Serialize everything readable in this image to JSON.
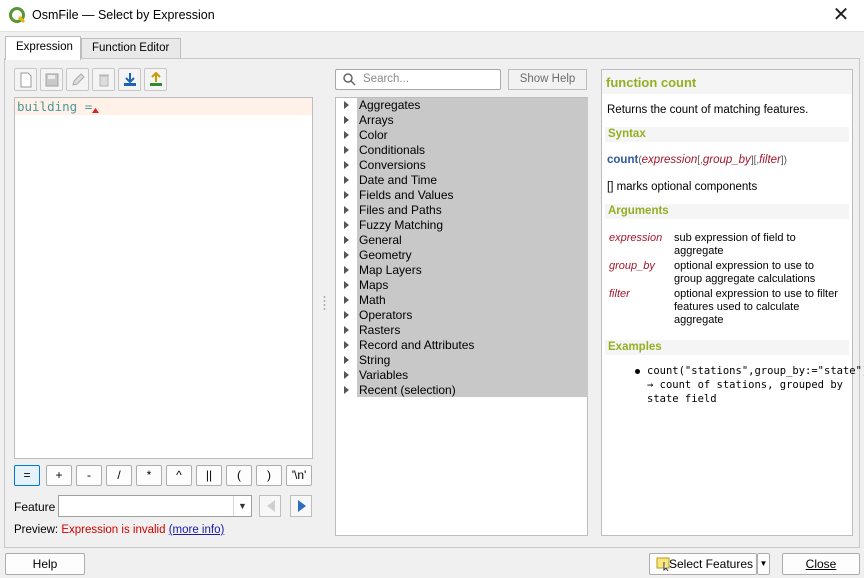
{
  "window": {
    "title": "OsmFile — Select by Expression",
    "close_glyph": "✕",
    "icon": "qgis-logo-icon"
  },
  "tabs": [
    {
      "label": "Expression",
      "active": true
    },
    {
      "label": "Function Editor",
      "active": false
    }
  ],
  "toolbar": {
    "icons": [
      "new-file-icon",
      "save-icon",
      "edit-icon",
      "delete-icon",
      "import-icon",
      "export-icon"
    ]
  },
  "editor": {
    "text": "building ="
  },
  "operators": [
    "=",
    "+",
    "-",
    "/",
    "*",
    "^",
    "||",
    "(",
    ")",
    "'\\n'"
  ],
  "feature": {
    "label": "Feature",
    "value": ""
  },
  "preview": {
    "label": "Preview:",
    "status": "Expression is invalid",
    "link": "(more info)"
  },
  "search": {
    "placeholder": "Search...",
    "show_help_label": "Show Help"
  },
  "tree": {
    "items": [
      "Aggregates",
      "Arrays",
      "Color",
      "Conditionals",
      "Conversions",
      "Date and Time",
      "Fields and Values",
      "Files and Paths",
      "Fuzzy Matching",
      "General",
      "Geometry",
      "Map Layers",
      "Maps",
      "Math",
      "Operators",
      "Rasters",
      "Record and Attributes",
      "String",
      "Variables",
      "Recent (selection)"
    ]
  },
  "help": {
    "title": "function count",
    "description": "Returns the count of matching features.",
    "syntax_heading": "Syntax",
    "syntax": {
      "fn": "count",
      "open": "(",
      "arg1": "expression",
      "opt1_open": "[,",
      "arg2": "group_by",
      "opt1_close": "]",
      "opt2_open": "[,",
      "arg3": "filter",
      "opt2_close": "]",
      "close": ")"
    },
    "optional_note": "[] marks optional components",
    "arguments_heading": "Arguments",
    "arguments": [
      {
        "name": "expression",
        "desc": "sub expression of field to aggregate"
      },
      {
        "name": "group_by",
        "desc": "optional expression to use to group aggregate calculations"
      },
      {
        "name": "filter",
        "desc": "optional expression to use to filter features used to calculate aggregate"
      }
    ],
    "examples_heading": "Examples",
    "example": "count(\"stations\",group_by:=\"state\") → count of stations, grouped by state field",
    "accent_color": "#93b023"
  },
  "buttons": {
    "help": "Help",
    "select_features": "Select Features",
    "close": "Close"
  }
}
